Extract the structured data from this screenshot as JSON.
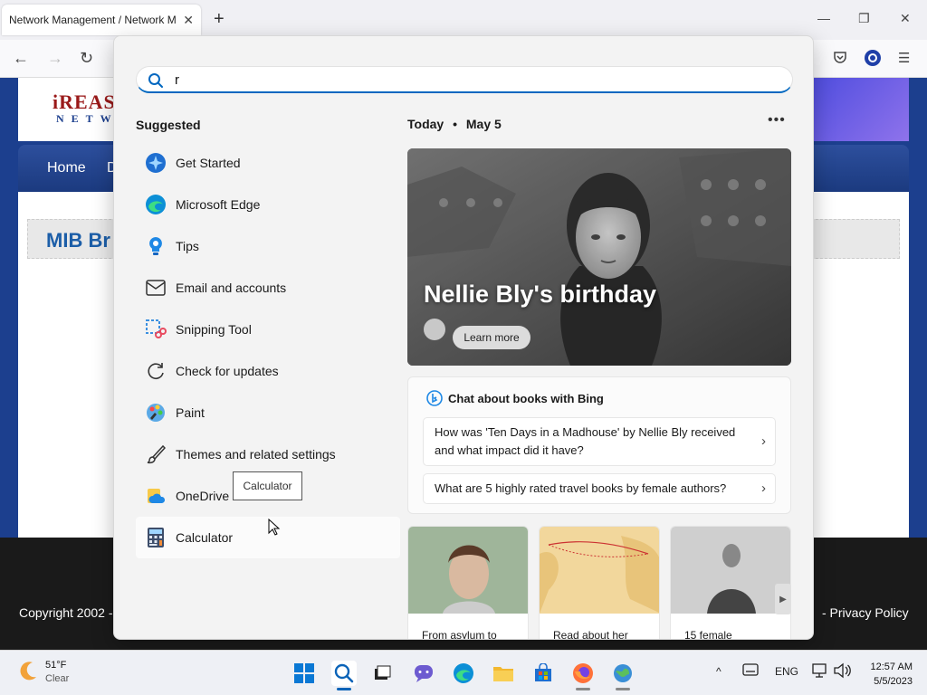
{
  "browser": {
    "tab_title": "Network Management / Network M",
    "tab_close": "✕",
    "new_tab": "+",
    "minimize": "—",
    "restore": "❐",
    "close": "✕",
    "back": "←",
    "forward": "→",
    "reload": "↻",
    "menu": "☰"
  },
  "site": {
    "logo": "iREASO",
    "logo_sub": "NETW",
    "nav": [
      "Home",
      "D"
    ],
    "mib_title": "MIB Br",
    "footer_left": "Copyright 2002 -",
    "footer_right": "- Privacy Policy"
  },
  "search": {
    "query": "r"
  },
  "suggested": {
    "title": "Suggested",
    "apps": [
      {
        "label": "Get Started",
        "icon": "get-started-icon"
      },
      {
        "label": "Microsoft Edge",
        "icon": "edge-icon"
      },
      {
        "label": "Tips",
        "icon": "tips-icon"
      },
      {
        "label": "Email and accounts",
        "icon": "mail-icon"
      },
      {
        "label": "Snipping Tool",
        "icon": "snipping-tool-icon"
      },
      {
        "label": "Check for updates",
        "icon": "refresh-icon"
      },
      {
        "label": "Paint",
        "icon": "paint-icon"
      },
      {
        "label": "Themes and related settings",
        "icon": "brush-icon"
      },
      {
        "label": "OneDrive",
        "icon": "onedrive-icon"
      },
      {
        "label": "Calculator",
        "icon": "calculator-icon"
      }
    ],
    "tooltip": "Calculator"
  },
  "today": {
    "label": "Today",
    "separator": "•",
    "date": "May 5",
    "more": "•••",
    "hero_title": "Nellie Bly's birthday",
    "learn_more": "Learn more"
  },
  "bing": {
    "title": "Chat about books with Bing",
    "questions": [
      "How was 'Ten Days in a Madhouse' by Nellie Bly received and what impact did it have?",
      "What are 5 highly rated travel books by female authors?"
    ],
    "chevron": "›"
  },
  "thumbs": [
    {
      "caption": "From asylum to"
    },
    {
      "caption": "Read about her"
    },
    {
      "caption": "15 female"
    }
  ],
  "taskbar": {
    "temp": "51°F",
    "condition": "Clear",
    "lang": "ENG",
    "time": "12:57 AM",
    "date": "5/5/2023",
    "chevron_up": "^"
  },
  "colors": {
    "accent": "#0067c0",
    "site_blue": "#1c3f8e"
  }
}
